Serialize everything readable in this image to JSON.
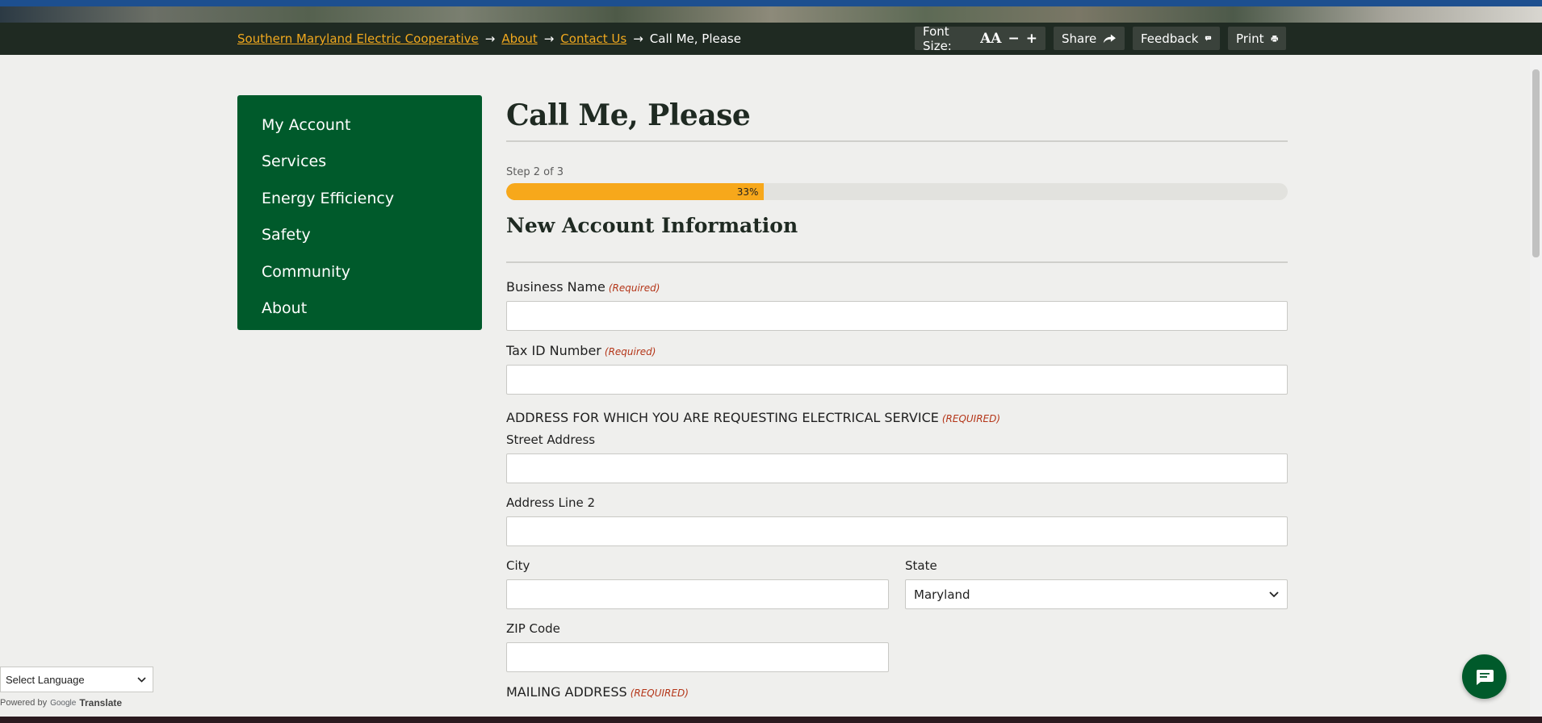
{
  "breadcrumb": {
    "items": [
      "Southern Maryland Electric Cooperative",
      "About",
      "Contact Us"
    ],
    "current": "Call Me, Please",
    "separator": "→"
  },
  "toolbar": {
    "font_size_label": "Font Size:",
    "font_icon_text": "AA",
    "minus": "−",
    "plus": "+",
    "share_label": "Share",
    "feedback_label": "Feedback",
    "print_label": "Print"
  },
  "sidebar": {
    "items": [
      {
        "label": "My Account"
      },
      {
        "label": "Services"
      },
      {
        "label": "Energy Efficiency"
      },
      {
        "label": "Safety"
      },
      {
        "label": "Community"
      },
      {
        "label": "About"
      }
    ]
  },
  "main": {
    "title": "Call Me, Please",
    "step_text": "Step 2 of 3",
    "progress_label": "33%",
    "progress_fraction": 0.33,
    "section_title": "New Account Information",
    "required_text": "(Required)",
    "required_caps": "(REQUIRED)",
    "fields": {
      "business_name": {
        "label": "Business Name",
        "value": ""
      },
      "tax_id": {
        "label": "Tax ID Number",
        "value": ""
      },
      "address_heading": "ADDRESS FOR WHICH YOU ARE REQUESTING ELECTRICAL SERVICE",
      "street": {
        "label": "Street Address",
        "value": ""
      },
      "address2": {
        "label": "Address Line 2",
        "value": ""
      },
      "city": {
        "label": "City",
        "value": ""
      },
      "state": {
        "label": "State",
        "value": "Maryland"
      },
      "zip": {
        "label": "ZIP Code",
        "value": ""
      },
      "mailing_heading": "MAILING ADDRESS"
    }
  },
  "translate": {
    "select_label": "Select Language",
    "powered_by": "Powered by",
    "google": "Google",
    "translate": "Translate"
  },
  "colors": {
    "accent_orange": "#f7a81b",
    "brand_green": "#005a2b",
    "required_red": "#b43518",
    "crumb_bar": "#1f2a22"
  },
  "icons": [
    "font-size-icon",
    "share-arrow-icon",
    "feedback-icon",
    "printer-icon",
    "chevron-down-icon",
    "chat-icon"
  ]
}
